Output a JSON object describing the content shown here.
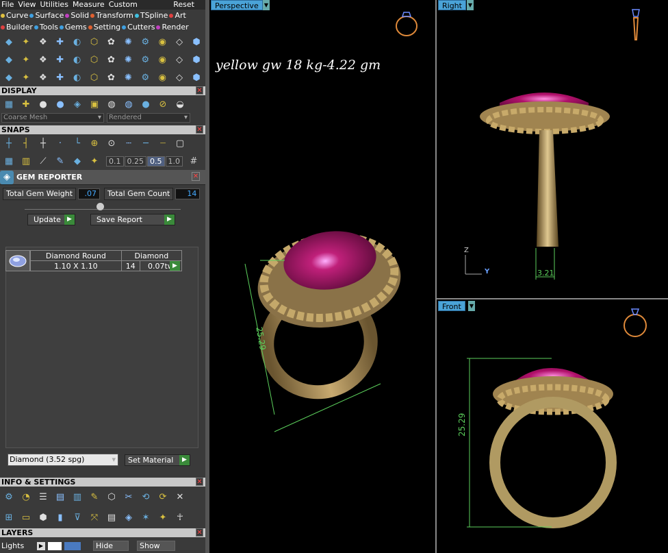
{
  "menu": {
    "items": [
      "File",
      "View",
      "Utilities",
      "Measure",
      "Custom"
    ],
    "reset": "Reset"
  },
  "categories_row1": [
    {
      "label": "Curve",
      "color": "#e0c040"
    },
    {
      "label": "Surface",
      "color": "#40a0e0"
    },
    {
      "label": "Solid",
      "color": "#c040c0"
    },
    {
      "label": "Transform",
      "color": "#e06030"
    },
    {
      "label": "TSpline",
      "color": "#40c0e0"
    },
    {
      "label": "Art",
      "color": "#e04040"
    }
  ],
  "categories_row2": [
    {
      "label": "Builder",
      "color": "#e04040"
    },
    {
      "label": "Tools",
      "color": "#40a0e0"
    },
    {
      "label": "Gems",
      "color": "#40a0e0"
    },
    {
      "label": "Setting",
      "color": "#e06030"
    },
    {
      "label": "Cutters",
      "color": "#40a0e0"
    },
    {
      "label": "Render",
      "color": "#c040c0"
    }
  ],
  "display": {
    "title": "DISPLAY",
    "mesh": "Coarse Mesh",
    "render": "Rendered"
  },
  "snaps": {
    "title": "SNAPS",
    "increments": [
      "0.1",
      "0.25",
      "0.5",
      "1.0"
    ],
    "active_increment": "0.5"
  },
  "gem_reporter": {
    "title": "GEM REPORTER",
    "total_weight_label": "Total Gem Weight",
    "total_weight": ".07",
    "total_count_label": "Total Gem Count",
    "total_count": "14",
    "update": "Update",
    "save_report": "Save Report",
    "table_headers": [
      "Diamond Round",
      "Diamond"
    ],
    "row": {
      "size": "1.10 X 1.10",
      "count": "14",
      "weight": "0.07tw"
    },
    "material": "Diamond     (3.52 spg)",
    "set_material": "Set Material"
  },
  "info": {
    "title": "INFO & SETTINGS"
  },
  "layers": {
    "title": "LAYERS",
    "lights": "Lights",
    "hide": "Hide",
    "show": "Show"
  },
  "viewports": {
    "perspective": {
      "label": "Perspective",
      "note": "yellow gw 18 kg-4.22 gm",
      "dim_a": "25.29"
    },
    "right": {
      "label": "Right",
      "dim": "3.21",
      "axis_z": "Z",
      "axis_y": "Y"
    },
    "front": {
      "label": "Front",
      "dim": "25.29"
    }
  },
  "colors": {
    "gold": "#a8905a",
    "gem": "#b0106a",
    "dimension": "#5cd05c",
    "tab": "#4aa3d8"
  }
}
